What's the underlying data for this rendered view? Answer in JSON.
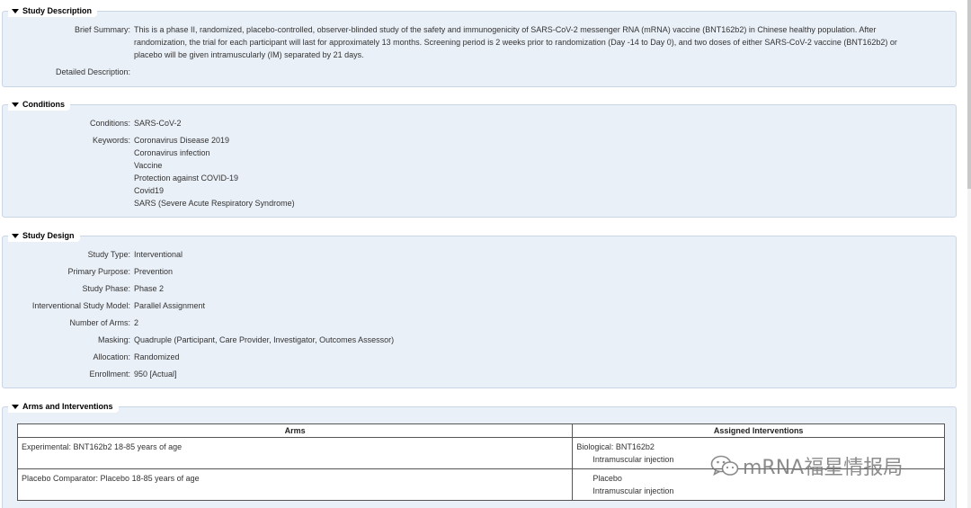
{
  "study_description": {
    "title": "Study Description",
    "brief_summary_label": "Brief Summary:",
    "brief_summary_line1": "This is a phase II, randomized, placebo-controlled, observer-blinded study of the safety and immunogenicity of SARS-CoV-2 messenger RNA (mRNA) vaccine (BNT162b2) in Chinese healthy population. After",
    "brief_summary_line2": "randomization, the trial for each participant will last for approximately 13 months. Screening period is 2 weeks prior to randomization (Day -14 to Day 0), and two doses of either SARS-CoV-2 vaccine (BNT162b2) or",
    "brief_summary_line3": "placebo will be given intramuscularly (IM) separated by 21 days.",
    "detailed_label": "Detailed Description:"
  },
  "conditions": {
    "title": "Conditions",
    "conditions_label": "Conditions:",
    "conditions_value": "SARS-CoV-2",
    "keywords_label": "Keywords:",
    "keywords": [
      "Coronavirus Disease 2019",
      "Coronavirus infection",
      "Vaccine",
      "Protection against COVID-19",
      "Covid19",
      "SARS (Severe Acute Respiratory Syndrome)"
    ]
  },
  "study_design": {
    "title": "Study Design",
    "rows": [
      {
        "label": "Study Type:",
        "value": "Interventional"
      },
      {
        "label": "Primary Purpose:",
        "value": "Prevention"
      },
      {
        "label": "Study Phase:",
        "value": "Phase 2"
      },
      {
        "label": "Interventional Study Model:",
        "value": "Parallel Assignment"
      },
      {
        "label": "Number of Arms:",
        "value": "2"
      },
      {
        "label": "Masking:",
        "value": "Quadruple (Participant, Care Provider, Investigator, Outcomes Assessor)"
      },
      {
        "label": "Allocation:",
        "value": "Randomized"
      },
      {
        "label": "Enrollment:",
        "value": "950 [Actual]"
      }
    ]
  },
  "arms": {
    "title": "Arms and Interventions",
    "col_arms": "Arms",
    "col_interventions": "Assigned Interventions",
    "rows": [
      {
        "arm": "Experimental: BNT162b2 18-85 years of age",
        "intervention_line1": "Biological: BNT162b2",
        "intervention_line2": "Intramuscular injection"
      },
      {
        "arm": "Placebo Comparator: Placebo 18-85 years of age",
        "intervention_line1": "Placebo",
        "intervention_line2": "Intramuscular injection"
      }
    ]
  },
  "watermark": {
    "text": "mRNA福星情报局"
  }
}
